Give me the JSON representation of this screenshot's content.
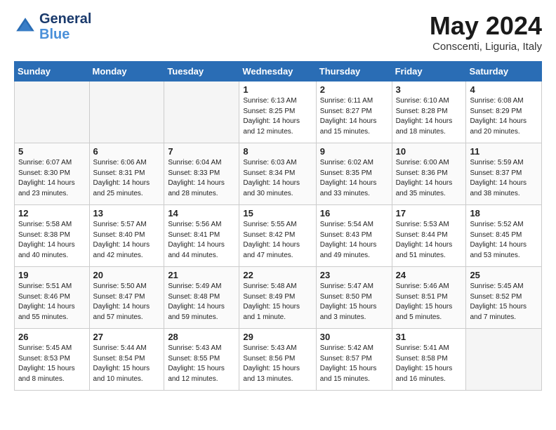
{
  "header": {
    "logo_line1": "General",
    "logo_line2": "Blue",
    "month_title": "May 2024",
    "location": "Conscenti, Liguria, Italy"
  },
  "weekdays": [
    "Sunday",
    "Monday",
    "Tuesday",
    "Wednesday",
    "Thursday",
    "Friday",
    "Saturday"
  ],
  "weeks": [
    [
      {
        "day": "",
        "info": ""
      },
      {
        "day": "",
        "info": ""
      },
      {
        "day": "",
        "info": ""
      },
      {
        "day": "1",
        "info": "Sunrise: 6:13 AM\nSunset: 8:25 PM\nDaylight: 14 hours\nand 12 minutes."
      },
      {
        "day": "2",
        "info": "Sunrise: 6:11 AM\nSunset: 8:27 PM\nDaylight: 14 hours\nand 15 minutes."
      },
      {
        "day": "3",
        "info": "Sunrise: 6:10 AM\nSunset: 8:28 PM\nDaylight: 14 hours\nand 18 minutes."
      },
      {
        "day": "4",
        "info": "Sunrise: 6:08 AM\nSunset: 8:29 PM\nDaylight: 14 hours\nand 20 minutes."
      }
    ],
    [
      {
        "day": "5",
        "info": "Sunrise: 6:07 AM\nSunset: 8:30 PM\nDaylight: 14 hours\nand 23 minutes."
      },
      {
        "day": "6",
        "info": "Sunrise: 6:06 AM\nSunset: 8:31 PM\nDaylight: 14 hours\nand 25 minutes."
      },
      {
        "day": "7",
        "info": "Sunrise: 6:04 AM\nSunset: 8:33 PM\nDaylight: 14 hours\nand 28 minutes."
      },
      {
        "day": "8",
        "info": "Sunrise: 6:03 AM\nSunset: 8:34 PM\nDaylight: 14 hours\nand 30 minutes."
      },
      {
        "day": "9",
        "info": "Sunrise: 6:02 AM\nSunset: 8:35 PM\nDaylight: 14 hours\nand 33 minutes."
      },
      {
        "day": "10",
        "info": "Sunrise: 6:00 AM\nSunset: 8:36 PM\nDaylight: 14 hours\nand 35 minutes."
      },
      {
        "day": "11",
        "info": "Sunrise: 5:59 AM\nSunset: 8:37 PM\nDaylight: 14 hours\nand 38 minutes."
      }
    ],
    [
      {
        "day": "12",
        "info": "Sunrise: 5:58 AM\nSunset: 8:38 PM\nDaylight: 14 hours\nand 40 minutes."
      },
      {
        "day": "13",
        "info": "Sunrise: 5:57 AM\nSunset: 8:40 PM\nDaylight: 14 hours\nand 42 minutes."
      },
      {
        "day": "14",
        "info": "Sunrise: 5:56 AM\nSunset: 8:41 PM\nDaylight: 14 hours\nand 44 minutes."
      },
      {
        "day": "15",
        "info": "Sunrise: 5:55 AM\nSunset: 8:42 PM\nDaylight: 14 hours\nand 47 minutes."
      },
      {
        "day": "16",
        "info": "Sunrise: 5:54 AM\nSunset: 8:43 PM\nDaylight: 14 hours\nand 49 minutes."
      },
      {
        "day": "17",
        "info": "Sunrise: 5:53 AM\nSunset: 8:44 PM\nDaylight: 14 hours\nand 51 minutes."
      },
      {
        "day": "18",
        "info": "Sunrise: 5:52 AM\nSunset: 8:45 PM\nDaylight: 14 hours\nand 53 minutes."
      }
    ],
    [
      {
        "day": "19",
        "info": "Sunrise: 5:51 AM\nSunset: 8:46 PM\nDaylight: 14 hours\nand 55 minutes."
      },
      {
        "day": "20",
        "info": "Sunrise: 5:50 AM\nSunset: 8:47 PM\nDaylight: 14 hours\nand 57 minutes."
      },
      {
        "day": "21",
        "info": "Sunrise: 5:49 AM\nSunset: 8:48 PM\nDaylight: 14 hours\nand 59 minutes."
      },
      {
        "day": "22",
        "info": "Sunrise: 5:48 AM\nSunset: 8:49 PM\nDaylight: 15 hours\nand 1 minute."
      },
      {
        "day": "23",
        "info": "Sunrise: 5:47 AM\nSunset: 8:50 PM\nDaylight: 15 hours\nand 3 minutes."
      },
      {
        "day": "24",
        "info": "Sunrise: 5:46 AM\nSunset: 8:51 PM\nDaylight: 15 hours\nand 5 minutes."
      },
      {
        "day": "25",
        "info": "Sunrise: 5:45 AM\nSunset: 8:52 PM\nDaylight: 15 hours\nand 7 minutes."
      }
    ],
    [
      {
        "day": "26",
        "info": "Sunrise: 5:45 AM\nSunset: 8:53 PM\nDaylight: 15 hours\nand 8 minutes."
      },
      {
        "day": "27",
        "info": "Sunrise: 5:44 AM\nSunset: 8:54 PM\nDaylight: 15 hours\nand 10 minutes."
      },
      {
        "day": "28",
        "info": "Sunrise: 5:43 AM\nSunset: 8:55 PM\nDaylight: 15 hours\nand 12 minutes."
      },
      {
        "day": "29",
        "info": "Sunrise: 5:43 AM\nSunset: 8:56 PM\nDaylight: 15 hours\nand 13 minutes."
      },
      {
        "day": "30",
        "info": "Sunrise: 5:42 AM\nSunset: 8:57 PM\nDaylight: 15 hours\nand 15 minutes."
      },
      {
        "day": "31",
        "info": "Sunrise: 5:41 AM\nSunset: 8:58 PM\nDaylight: 15 hours\nand 16 minutes."
      },
      {
        "day": "",
        "info": ""
      }
    ]
  ]
}
